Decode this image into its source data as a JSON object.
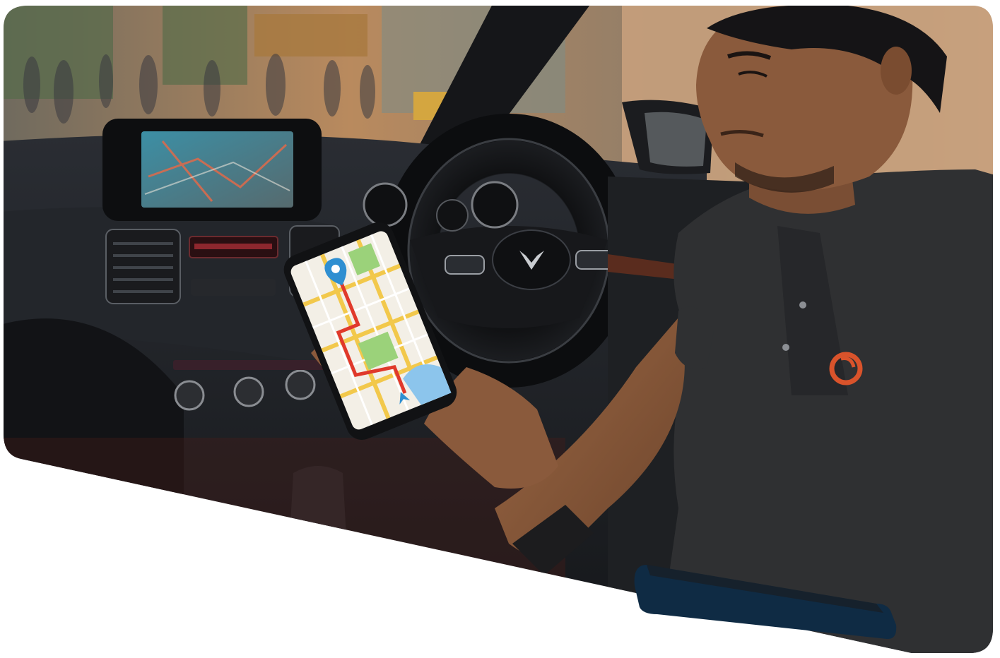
{
  "scene": {
    "subject": "driver-using-phone-navigation",
    "colors": {
      "cabin_dark": "#1c1e22",
      "dashboard": "#2a2d33",
      "shirt": "#2f3032",
      "skin": "#8a5a3c",
      "street_warm": "#b98a5e",
      "map_bg": "#f3efe6",
      "map_route": "#e0392b",
      "map_pin": "#2f8fd1",
      "badge_navy": "#0f2b44",
      "logo_orange": "#d9532b"
    }
  }
}
